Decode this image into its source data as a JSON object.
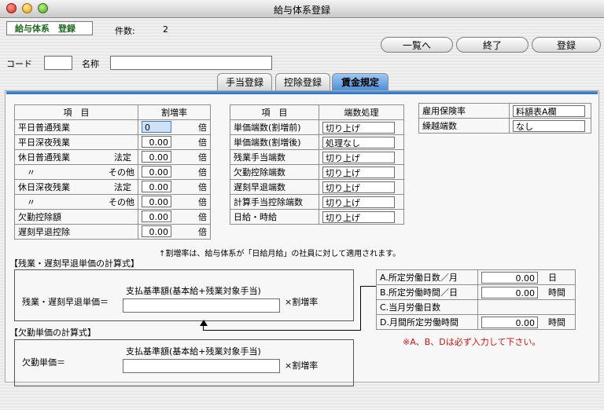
{
  "window": {
    "title": "給与体系登録"
  },
  "header": {
    "mode": "給与体系　登録",
    "count_label": "件数:",
    "count_value": "2"
  },
  "buttons": {
    "list": "一覧へ",
    "close": "終了",
    "register": "登録"
  },
  "fields": {
    "code_label": "コード",
    "name_label": "名称",
    "code_value": "",
    "name_value": ""
  },
  "tabs": [
    {
      "label": "手当登録",
      "active": false
    },
    {
      "label": "控除登録",
      "active": false
    },
    {
      "label": "賃金規定",
      "active": true
    }
  ],
  "rates_table": {
    "header_item": "項　目",
    "header_rate": "割増率",
    "unit": "倍",
    "rows": [
      {
        "item": "平日普通残業",
        "sub": "",
        "value": "0"
      },
      {
        "item": "平日深夜残業",
        "sub": "",
        "value": "0.00"
      },
      {
        "item": "休日普通残業",
        "sub": "法定",
        "value": "0.00"
      },
      {
        "item": "　〃",
        "sub": "その他",
        "value": "0.00"
      },
      {
        "item": "休日深夜残業",
        "sub": "法定",
        "value": "0.00"
      },
      {
        "item": "　〃",
        "sub": "その他",
        "value": "0.00"
      },
      {
        "item": "欠勤控除額",
        "sub": "",
        "value": "0.00"
      },
      {
        "item": "遅刻早退控除",
        "sub": "",
        "value": "0.00"
      }
    ],
    "note": "↑割増率は、給与体系が「日給月給」の社員に対して適用されます。"
  },
  "rounding_table": {
    "header_item": "項　目",
    "header_value": "端数処理",
    "rows": [
      {
        "item": "単価端数(割増前)",
        "value": "切り上げ"
      },
      {
        "item": "単価端数(割増後)",
        "value": "処理なし"
      },
      {
        "item": "残業手当端数",
        "value": "切り上げ"
      },
      {
        "item": "欠勤控除端数",
        "value": "切り上げ"
      },
      {
        "item": "遅刻早退端数",
        "value": "切り上げ"
      },
      {
        "item": "計算手当控除端数",
        "value": "切り上げ"
      },
      {
        "item": "日給・時給",
        "value": "切り上げ"
      }
    ]
  },
  "insurance_table": {
    "rows": [
      {
        "item": "雇用保険率",
        "value": "料額表A欄"
      },
      {
        "item": "繰越端数",
        "value": "なし"
      }
    ]
  },
  "formula_overtime": {
    "title": "【残業・遅刻早退単価の計算式】",
    "label": "残業・遅刻早退単価＝",
    "numerator": "支払基準額(基本給+残業対象手当)",
    "multiplier": "×割増率"
  },
  "formula_absence": {
    "title": "【欠勤単価の計算式】",
    "label": "欠勤単価＝",
    "numerator": "支払基準額(基本給+残業対象手当)",
    "multiplier": "×割増率"
  },
  "work_table": {
    "rows": [
      {
        "item": "A.所定労働日数／月",
        "value": "0.00",
        "unit": "日"
      },
      {
        "item": "B.所定労働時間／日",
        "value": "0.00",
        "unit": "時間"
      },
      {
        "item": "C.当月労働日数",
        "value": "",
        "unit": ""
      },
      {
        "item": "D.月間所定労働時間",
        "value": "0.00",
        "unit": "時間"
      }
    ],
    "note": "※A、B、Dは必ず入力して下さい。"
  },
  "colors": {
    "accent": "#3d7fd0",
    "mode_text": "#1a6a1a",
    "note_red": "#d31212"
  }
}
